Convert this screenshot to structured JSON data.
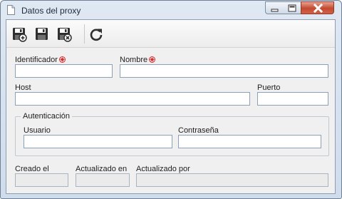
{
  "window": {
    "title": "Datos del proxy",
    "controls": {
      "minimize": "minimize-icon",
      "maximize": "maximize-icon",
      "close": "close-icon"
    }
  },
  "toolbar": {
    "buttons": [
      {
        "icon": "save-new-icon",
        "tooltip": ""
      },
      {
        "icon": "save-icon",
        "tooltip": ""
      },
      {
        "icon": "save-close-icon",
        "tooltip": ""
      },
      {
        "icon": "refresh-icon",
        "tooltip": ""
      }
    ]
  },
  "form": {
    "identifier": {
      "label": "Identificador",
      "required": true,
      "value": ""
    },
    "name": {
      "label": "Nombre",
      "required": true,
      "value": ""
    },
    "host": {
      "label": "Host",
      "value": ""
    },
    "port": {
      "label": "Puerto",
      "value": ""
    },
    "auth": {
      "title": "Autenticación",
      "user": {
        "label": "Usuario",
        "value": ""
      },
      "password": {
        "label": "Contraseña",
        "value": ""
      }
    },
    "created_on": {
      "label": "Creado el",
      "value": ""
    },
    "updated_on": {
      "label": "Actualizado en",
      "value": ""
    },
    "updated_by": {
      "label": "Actualizado por",
      "value": ""
    }
  },
  "colors": {
    "required_marker": "#d42a2a",
    "window_frame": "#cfdcec",
    "close_button": "#c24a30"
  }
}
